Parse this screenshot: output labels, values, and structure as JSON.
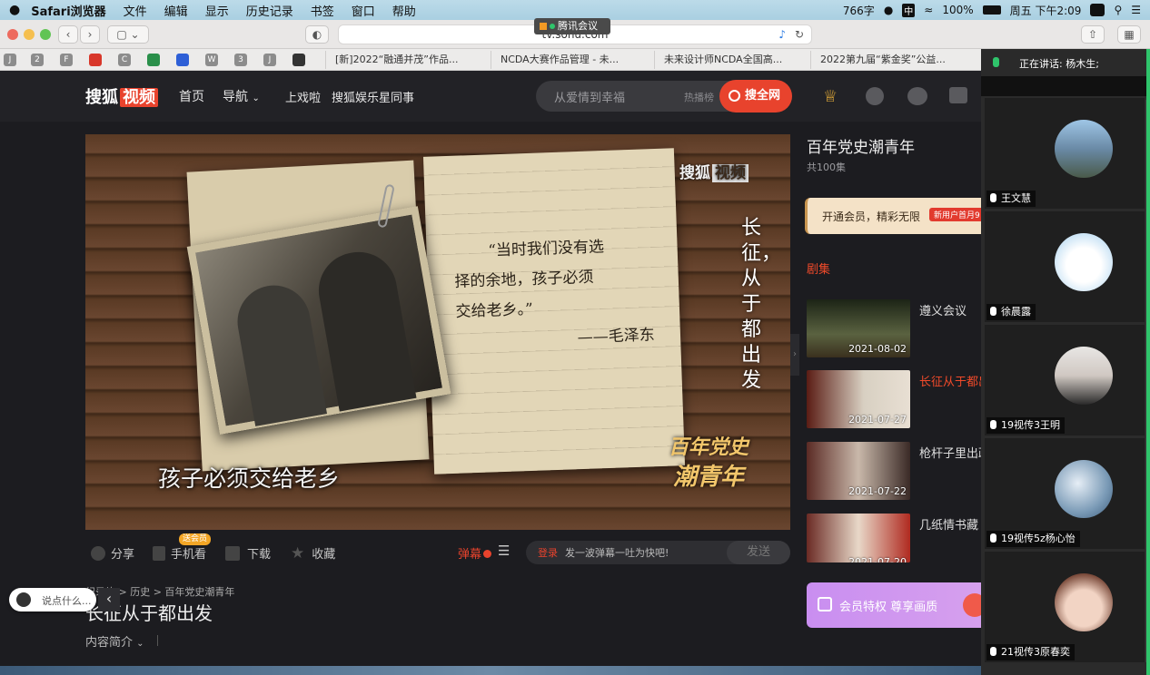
{
  "macbar": {
    "app": "Safari浏览器",
    "menus": [
      "文件",
      "编辑",
      "显示",
      "历史记录",
      "书签",
      "窗口",
      "帮助"
    ],
    "word_count": "766字",
    "battery": "100%",
    "datetime": "周五 下午2:09"
  },
  "browser": {
    "url": "tv.sohu.com",
    "tencent_label": "腾讯会议",
    "tabs": [
      "[新]2022“融通并茂”作品...",
      "NCDA大赛作品管理 - 未...",
      "未来设计师NCDA全国高...",
      "2022第九届“紫金奖”公益..."
    ],
    "favs": [
      "J",
      "2",
      "F",
      "",
      "C",
      "",
      "",
      "W",
      "3",
      "J",
      ""
    ]
  },
  "site": {
    "logo_a": "搜狐",
    "logo_b": "视频",
    "nav": [
      "首页",
      "导航",
      "上戏啦",
      "搜狐娱乐星同事"
    ],
    "search_placeholder": "从爱情到幸福",
    "hot_label": "热播榜",
    "search_button": "搜全网"
  },
  "video": {
    "watermark_a": "搜狐",
    "watermark_b": "视频",
    "quote_lines": [
      "“当时我们没有选",
      "择的余地，孩子必须",
      "交给老乡。”"
    ],
    "quote_author": "——毛泽东",
    "vertical_title": "长征，从于都出发",
    "subtitle": "孩子必须交给老乡",
    "series_logo": [
      "百年党史",
      "潮青年"
    ]
  },
  "controls": {
    "share": "分享",
    "mobile": "手机看",
    "mobile_badge": "送会员",
    "download": "下载",
    "collect": "收藏",
    "danmu": "弹幕",
    "login": "登录",
    "danmu_placeholder": "发一波弹幕一吐为快吧!",
    "send": "发送"
  },
  "info": {
    "breadcrumb": "纪录片 > 历史 > 百年党史潮青年",
    "title": "长征从于都出发",
    "intro": "内容简介",
    "chat_placeholder": "说点什么..."
  },
  "panel": {
    "series_title": "百年党史潮青年",
    "count": "共100集",
    "vip_text": "开通会员，精彩无限",
    "vip_badge": "新用户首月9",
    "tab": "剧集",
    "episodes": [
      {
        "title": "遵义会议",
        "date": "2021-08-02"
      },
      {
        "title": "长征从于都出发",
        "date": "2021-07-27"
      },
      {
        "title": "枪杆子里出政",
        "date": "2021-07-22"
      },
      {
        "title": "几纸情书藏",
        "date": "2021-07-20"
      }
    ],
    "vip_banner": "会员特权 尊享画质"
  },
  "meeting": {
    "speaking": "正在讲话: 杨木生;",
    "participants": [
      "王文慧",
      "徐晨露",
      "19视传3王明",
      "19视传5z杨心怡",
      "21视传3原春奕"
    ]
  },
  "colors": {
    "accent": "#e8432d",
    "active_episode": "#f04a2a",
    "meeting_bg": "#2b2b2b"
  }
}
